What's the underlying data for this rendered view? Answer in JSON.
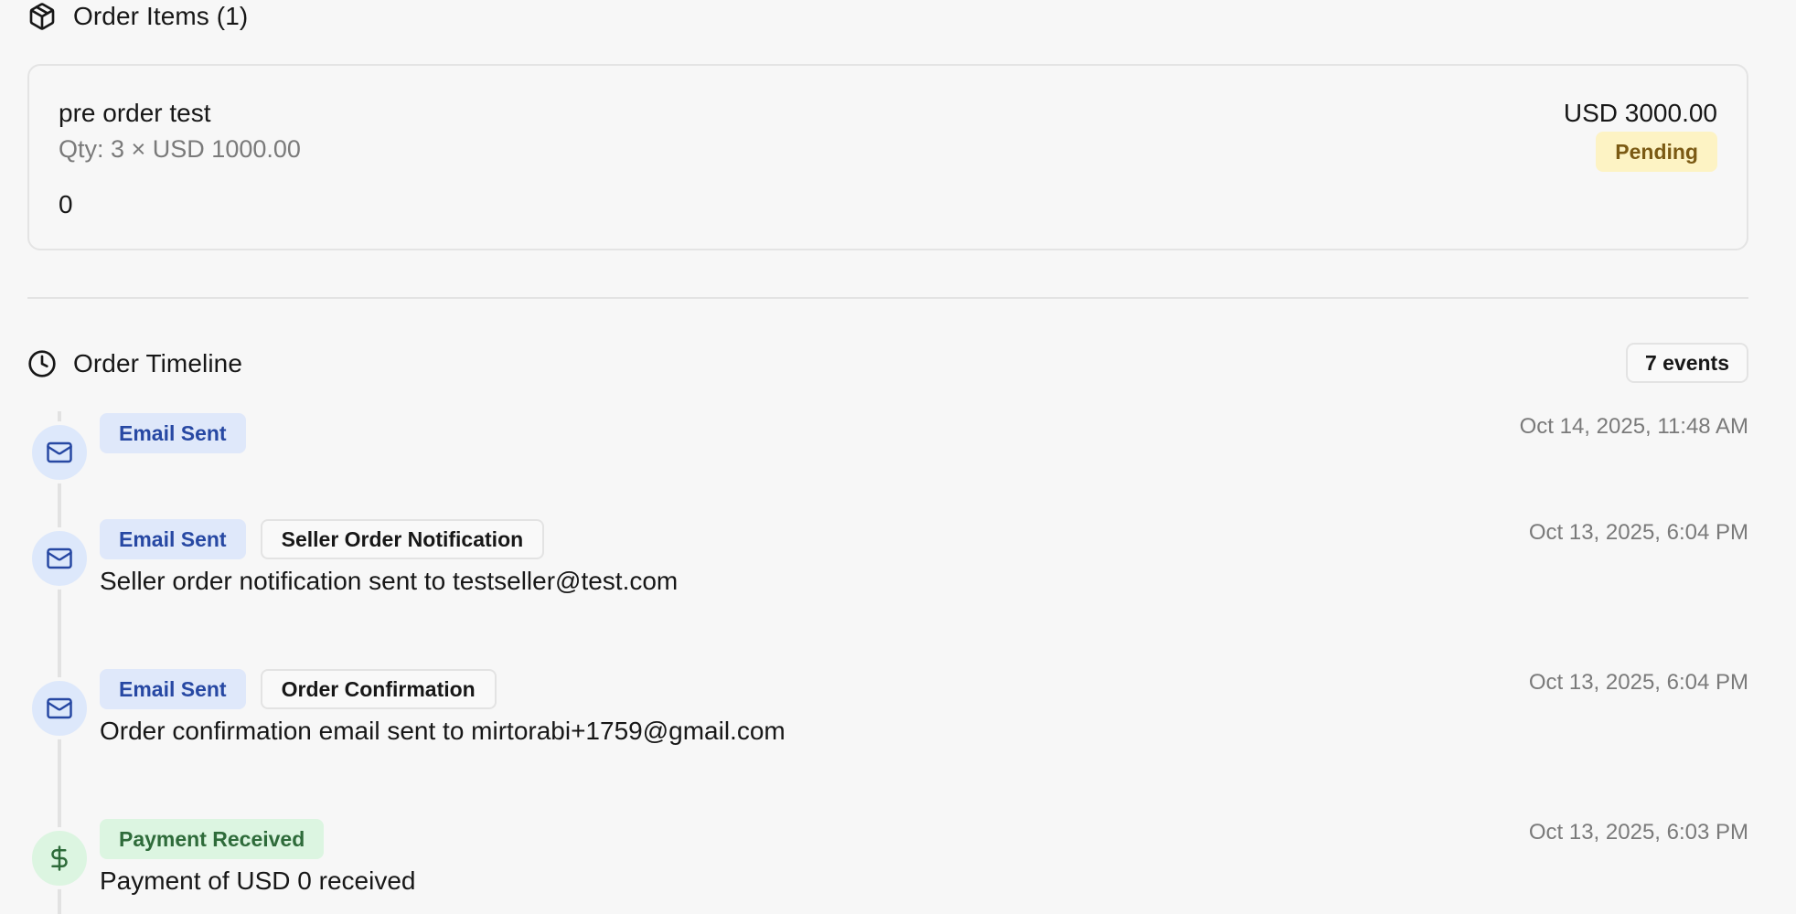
{
  "order_items": {
    "title": "Order Items (1)",
    "icon": "package-icon",
    "items": [
      {
        "name": "pre order test",
        "qty_line": "Qty: 3 × USD 1000.00",
        "extra": "0",
        "total": "USD 3000.00",
        "status": "Pending"
      }
    ]
  },
  "timeline": {
    "title": "Order Timeline",
    "icon": "clock-icon",
    "count_label": "7 events",
    "events": [
      {
        "icon": "mail-icon",
        "type_label": "Email Sent",
        "template_label": "",
        "description": "",
        "time": "Oct 14, 2025, 11:48 AM"
      },
      {
        "icon": "mail-icon",
        "type_label": "Email Sent",
        "template_label": "Seller Order Notification",
        "description": "Seller order notification sent to testseller@test.com",
        "time": "Oct 13, 2025, 6:04 PM"
      },
      {
        "icon": "mail-icon",
        "type_label": "Email Sent",
        "template_label": "Order Confirmation",
        "description": "Order confirmation email sent to mirtorabi+1759@gmail.com",
        "time": "Oct 13, 2025, 6:04 PM"
      },
      {
        "icon": "dollar-icon",
        "type_label": "Payment Received",
        "template_label": "",
        "description": "Payment of USD 0 received",
        "time": "Oct 13, 2025, 6:03 PM"
      }
    ]
  },
  "colors": {
    "email_badge_bg": "#dfe8fa",
    "email_badge_text": "#2748a3",
    "payment_badge_bg": "#dcf5e1",
    "payment_badge_text": "#2e6b3a",
    "pending_badge_bg": "#fdf3c4",
    "pending_badge_text": "#7b5a14"
  }
}
